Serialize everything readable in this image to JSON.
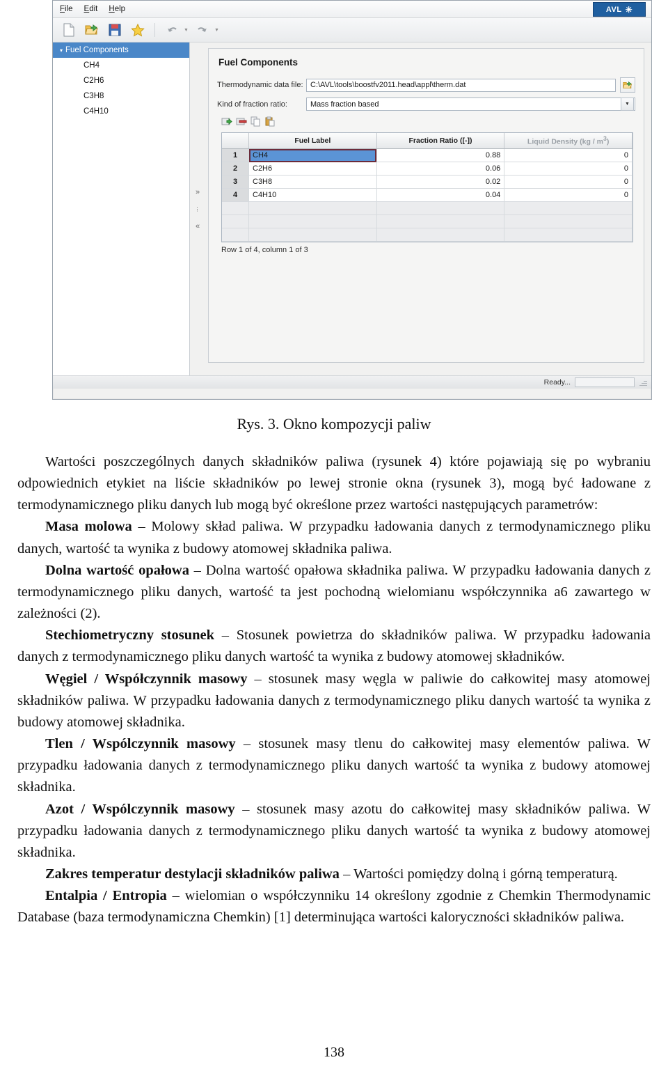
{
  "app": {
    "menu": [
      {
        "label": "File",
        "mnemonic": "F"
      },
      {
        "label": "Edit",
        "mnemonic": "E"
      },
      {
        "label": "Help",
        "mnemonic": "H"
      }
    ],
    "brand": {
      "name": "AVL",
      "mark": "✳"
    },
    "toolbar": [
      {
        "name": "new-document-icon",
        "label": "New"
      },
      {
        "name": "open-folder-icon",
        "label": "Open"
      },
      {
        "name": "save-icon",
        "label": "Save"
      },
      {
        "name": "favorite-star-icon",
        "label": "Favorite"
      },
      {
        "name": "undo-icon",
        "label": "Undo"
      },
      {
        "name": "redo-icon",
        "label": "Redo"
      }
    ],
    "tree": {
      "root": {
        "label": "Fuel Components",
        "selected": true,
        "expanded": true
      },
      "children": [
        "CH4",
        "C2H6",
        "C3H8",
        "C4H10"
      ]
    },
    "splitter": {
      "expand": "»",
      "dots": "⋮",
      "collapse": "«"
    },
    "panel": {
      "title": "Fuel Components",
      "fields": [
        {
          "label": "Thermodynamic data file:",
          "value": "C:\\AVL\\tools\\boostfv2011.head\\appl\\therm.dat",
          "placeholder": "Thermodynamic data file path",
          "browse_label": "Browse"
        },
        {
          "label": "Kind of fraction ratio:",
          "value": "Mass fraction based",
          "arrow": "▼"
        }
      ],
      "grid_toolbar": [
        {
          "name": "add-row-icon",
          "label": "Add"
        },
        {
          "name": "delete-row-icon",
          "label": "Delete"
        },
        {
          "name": "copy-icon",
          "label": "Copy"
        },
        {
          "name": "paste-icon",
          "label": "Paste"
        }
      ]
    },
    "grid": {
      "headers": [
        "",
        "Fuel Label",
        "Fraction Ratio ([-])",
        "Liquid Density (kg / m",
        "3",
        ")"
      ],
      "header_index": "",
      "header_label": "Fuel Label",
      "header_ratio": "Fraction Ratio ([-])",
      "header_density_pre": "Liquid Density (kg / m",
      "header_density_sup": "3",
      "header_density_post": ")",
      "rows": [
        {
          "index": "1",
          "label": "CH4",
          "ratio": "0.88",
          "density": "0",
          "selected": true
        },
        {
          "index": "2",
          "label": "C2H6",
          "ratio": "0.06",
          "density": "0",
          "selected": false
        },
        {
          "index": "3",
          "label": "C3H8",
          "ratio": "0.02",
          "density": "0",
          "selected": false
        },
        {
          "index": "4",
          "label": "C4H10",
          "ratio": "0.04",
          "density": "0",
          "selected": false
        }
      ],
      "empty_rows": 3,
      "status": "Row 1 of 4, column 1 of 3"
    },
    "statusbar": {
      "text": "Ready..."
    },
    "colors": {
      "selection_blue": "#4a87c8",
      "cell_selection": "#5b94d6",
      "brand_blue": "#1f5fa0",
      "window_chrome": "#f1f1f0"
    }
  },
  "document": {
    "caption": "Rys. 3. Okno kompozycji paliw",
    "paragraphs": [
      {
        "id": "intro",
        "indent": true,
        "runs": [
          {
            "bold": false,
            "text": "Wartości poszczególnych danych składników paliwa (rysunek 4) które pojawiają się po wybraniu odpowiednich etykiet na liście składników po lewej stronie okna (rysunek 3), mogą być ładowane z termodynamicznego pliku danych lub mogą być określone przez wartości następujących parametrów:"
          }
        ]
      },
      {
        "id": "masa-molowa",
        "indent": true,
        "runs": [
          {
            "bold": true,
            "text": "Masa molowa"
          },
          {
            "bold": false,
            "text": " – Molowy skład paliwa. W przypadku ładowania danych z termodynamicznego pliku danych, wartość ta wynika z budowy atomowej składnika paliwa."
          }
        ]
      },
      {
        "id": "dolna-wartosc-opalowa",
        "indent": true,
        "runs": [
          {
            "bold": true,
            "text": "Dolna wartość opałowa"
          },
          {
            "bold": false,
            "text": " – Dolna wartość opałowa składnika paliwa. W przypadku ładowania danych z termodynamicznego pliku danych, wartość ta jest pochodną wielomianu współczynnika a6 zawartego w zależności (2)."
          }
        ]
      },
      {
        "id": "stechiometryczny-stosunek",
        "indent": true,
        "runs": [
          {
            "bold": true,
            "text": "Stechiometryczny stosunek"
          },
          {
            "bold": false,
            "text": " – Stosunek powietrza do składników paliwa. W przypadku ładowania danych z termodynamicznego pliku danych wartość ta wynika z budowy atomowej składników."
          }
        ]
      },
      {
        "id": "wegiel-wspolczynnik-masowy",
        "indent": true,
        "runs": [
          {
            "bold": true,
            "text": "Węgiel / Współczynnik masowy"
          },
          {
            "bold": false,
            "text": " – stosunek masy węgla w paliwie do całkowitej masy atomowej składników paliwa. W przypadku ładowania danych z termodynamicznego pliku danych wartość ta wynika z budowy atomowej składnika."
          }
        ]
      },
      {
        "id": "tlen-wspolczynnik-masowy",
        "indent": true,
        "runs": [
          {
            "bold": true,
            "text": "Tlen / Wspólczynnik masowy"
          },
          {
            "bold": false,
            "text": " – stosunek masy tlenu do całkowitej masy elementów paliwa. W przypadku ładowania danych z termodynamicznego pliku danych wartość ta wynika z budowy atomowej składnika."
          }
        ]
      },
      {
        "id": "azot-wspolczynnik-masowy",
        "indent": true,
        "runs": [
          {
            "bold": true,
            "text": "Azot / Wspólczynnik masowy"
          },
          {
            "bold": false,
            "text": " – stosunek masy azotu do całkowitej masy składników paliwa. W przypadku ładowania danych z termodynamicznego pliku danych wartość ta wynika z budowy atomowej składnika."
          }
        ]
      },
      {
        "id": "zakres-temperatur",
        "indent": true,
        "runs": [
          {
            "bold": true,
            "text": "Zakres temperatur destylacji składników paliwa"
          },
          {
            "bold": false,
            "text": " – Wartości pomiędzy dolną i górną temperaturą."
          }
        ]
      },
      {
        "id": "entalpia-entropia",
        "indent": true,
        "runs": [
          {
            "bold": true,
            "text": "Entalpia / Entropia"
          },
          {
            "bold": false,
            "text": " – wielomian o współczynniku 14 określony zgodnie z Chemkin Thermodynamic Database (baza termodynamiczna Chemkin) [1] determinująca wartości kaloryczności składników paliwa."
          }
        ]
      }
    ],
    "page_number": "138"
  }
}
